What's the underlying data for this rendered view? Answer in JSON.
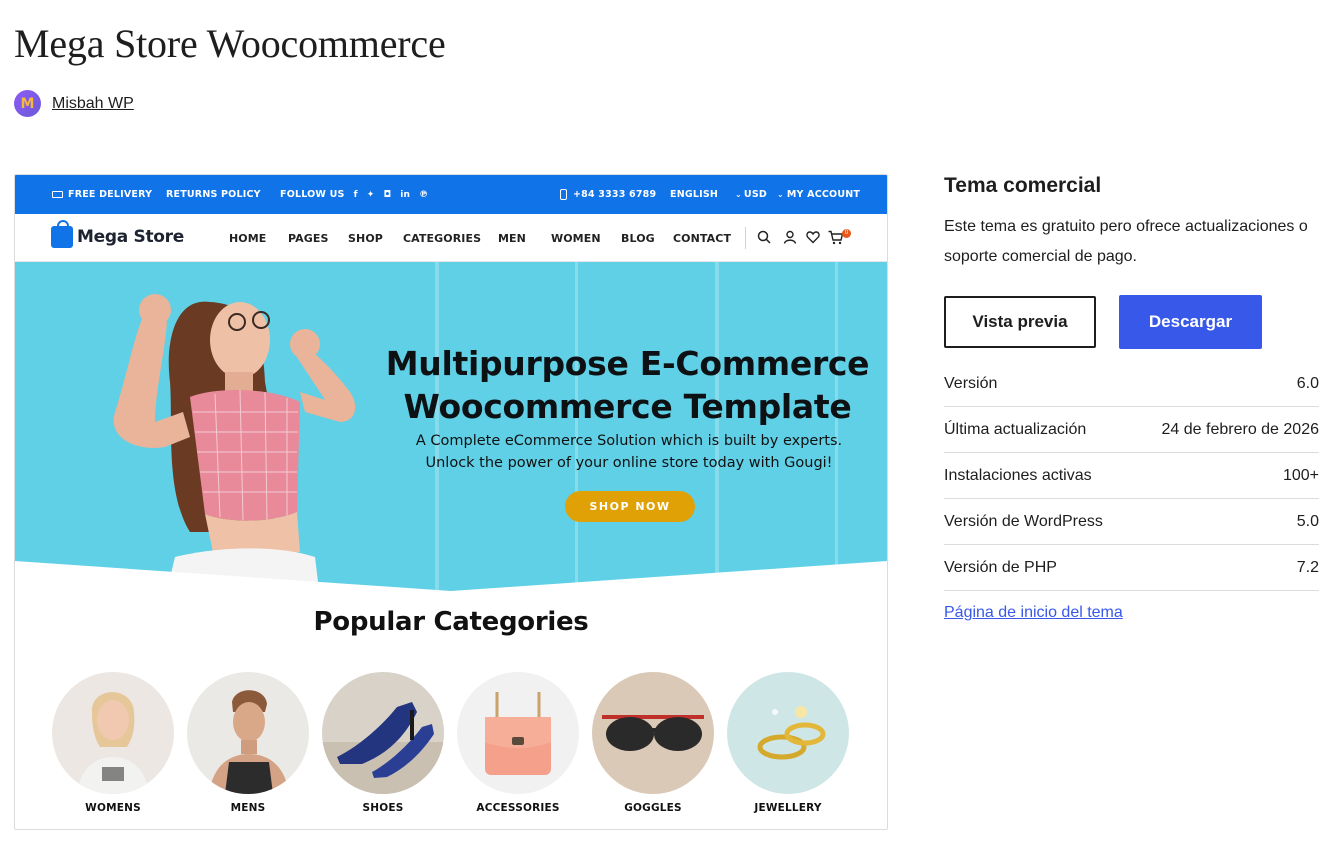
{
  "theme": {
    "title": "Mega Store Woocommerce",
    "author": "Misbah WP",
    "author_initial": "M"
  },
  "screenshot": {
    "topbar": {
      "free_delivery": "FREE DELIVERY",
      "returns_policy": "RETURNS POLICY",
      "follow_us": "FOLLOW US",
      "socials": [
        "f",
        "t",
        "ig",
        "in",
        "p"
      ],
      "phone": "+84 3333 6789",
      "language": "ENGLISH",
      "currency": "USD",
      "account": "MY ACCOUNT"
    },
    "logo": "Mega Store",
    "nav": [
      "HOME",
      "PAGES",
      "SHOP",
      "CATEGORIES",
      "MEN",
      "WOMEN",
      "BLOG",
      "CONTACT"
    ],
    "cart_count": "0",
    "hero": {
      "title_line1": "Multipurpose E-Commerce",
      "title_line2": "Woocommerce Template",
      "subtitle_line1": "A Complete eCommerce Solution which is built by experts.",
      "subtitle_line2": "Unlock the power of your online store today with Gougi!",
      "cta": "SHOP NOW"
    },
    "popular_title": "Popular Categories",
    "categories": [
      "WOMENS",
      "MENS",
      "SHOES",
      "ACCESSORIES",
      "GOGGLES",
      "JEWELLERY"
    ]
  },
  "side": {
    "title": "Tema comercial",
    "description": "Este tema es gratuito pero ofrece actualizaciones o soporte comercial de pago.",
    "preview_label": "Vista previa",
    "download_label": "Descargar",
    "meta": [
      {
        "label": "Versión",
        "value": "6.0"
      },
      {
        "label": "Última actualización",
        "value": "24 de febrero de 2026"
      },
      {
        "label": "Instalaciones activas",
        "value": "100+"
      },
      {
        "label": "Versión de WordPress",
        "value": "5.0"
      },
      {
        "label": "Versión de PHP",
        "value": "7.2"
      }
    ],
    "homepage_link": "Página de inicio del tema"
  },
  "colors": {
    "brand_blue": "#1173e8",
    "download_blue": "#3858e9",
    "cta_gold": "#e0a106",
    "hero_cyan": "#5fd0e6"
  }
}
